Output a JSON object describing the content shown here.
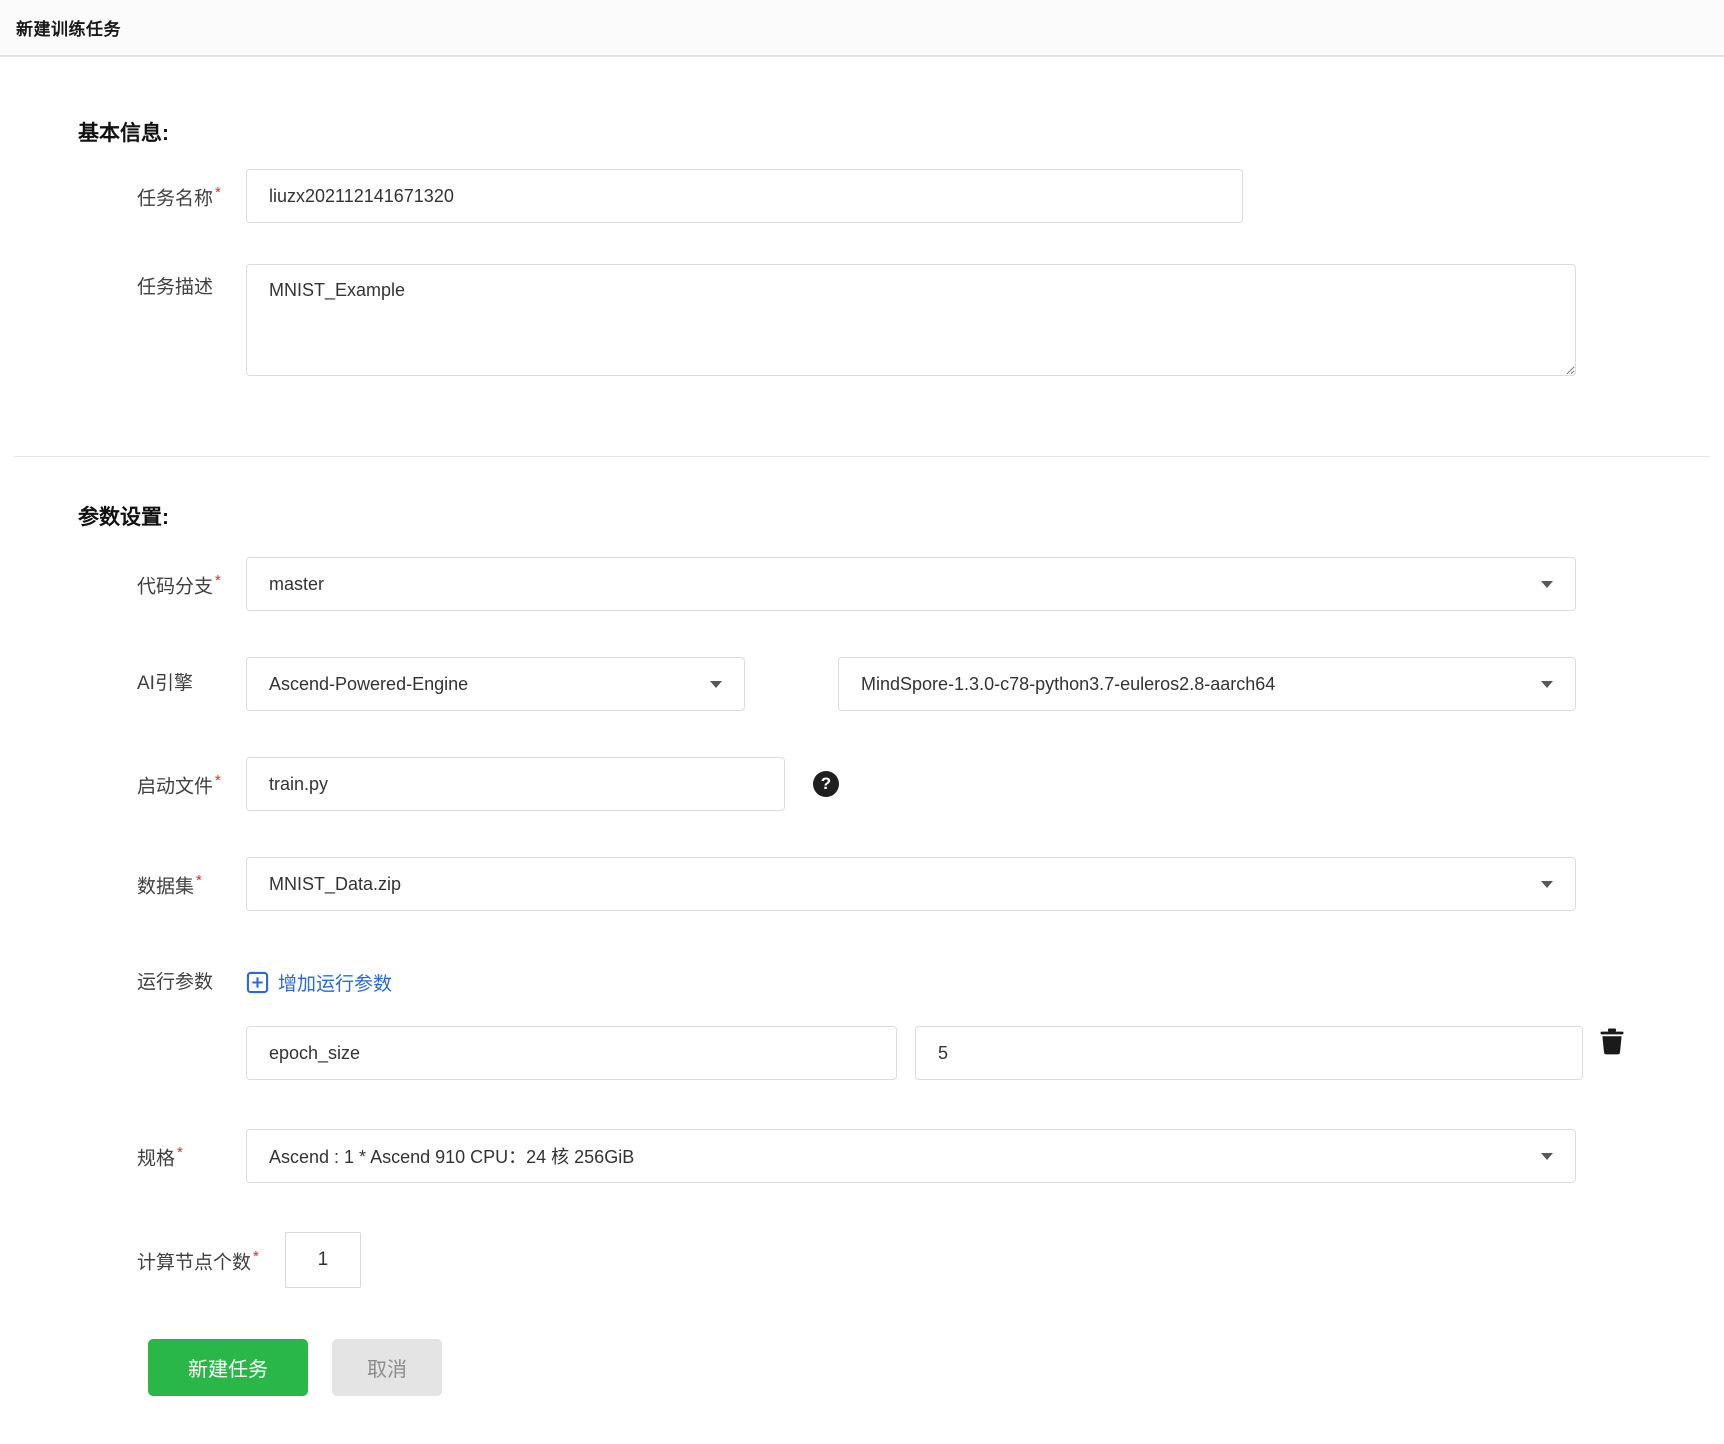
{
  "header": {
    "title": "新建训练任务"
  },
  "basic_info": {
    "heading": "基本信息:",
    "task_name": {
      "label": "任务名称",
      "required": "*",
      "value": "liuzx202112141671320"
    },
    "task_desc": {
      "label": "任务描述",
      "value": "MNIST_Example"
    }
  },
  "params": {
    "heading": "参数设置:",
    "code_branch": {
      "label": "代码分支",
      "required": "*",
      "value": "master"
    },
    "ai_engine": {
      "label": "AI引擎",
      "engine_value": "Ascend-Powered-Engine",
      "version_value": "MindSpore-1.3.0-c78-python3.7-euleros2.8-aarch64"
    },
    "boot_file": {
      "label": "启动文件",
      "required": "*",
      "value": "train.py"
    },
    "dataset": {
      "label": "数据集",
      "required": "*",
      "value": "MNIST_Data.zip"
    },
    "run_params": {
      "label": "运行参数",
      "add_link": "增加运行参数",
      "rows": [
        {
          "key": "epoch_size",
          "value": "5"
        }
      ]
    },
    "spec": {
      "label": "规格",
      "required": "*",
      "value": "Ascend : 1 * Ascend 910 CPU：24 核 256GiB"
    },
    "node_count": {
      "label": "计算节点个数",
      "required": "*",
      "value": "1"
    }
  },
  "actions": {
    "create": "新建任务",
    "cancel": "取消"
  },
  "colors": {
    "primary_green": "#29b848",
    "link_blue": "#2a6bd2",
    "required_red": "#e02a2a",
    "header_bg": "#fbfbfb",
    "input_border": "#dcdcdc"
  }
}
